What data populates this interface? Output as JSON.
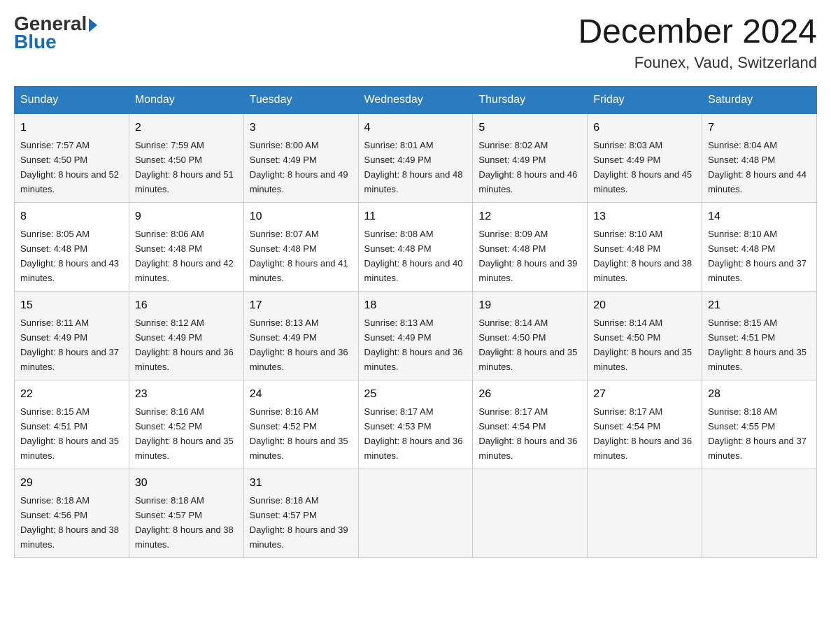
{
  "logo": {
    "general": "General",
    "blue": "Blue"
  },
  "title": "December 2024",
  "location": "Founex, Vaud, Switzerland",
  "days_header": [
    "Sunday",
    "Monday",
    "Tuesday",
    "Wednesday",
    "Thursday",
    "Friday",
    "Saturday"
  ],
  "weeks": [
    [
      {
        "num": "1",
        "sunrise": "7:57 AM",
        "sunset": "4:50 PM",
        "daylight": "8 hours and 52 minutes."
      },
      {
        "num": "2",
        "sunrise": "7:59 AM",
        "sunset": "4:50 PM",
        "daylight": "8 hours and 51 minutes."
      },
      {
        "num": "3",
        "sunrise": "8:00 AM",
        "sunset": "4:49 PM",
        "daylight": "8 hours and 49 minutes."
      },
      {
        "num": "4",
        "sunrise": "8:01 AM",
        "sunset": "4:49 PM",
        "daylight": "8 hours and 48 minutes."
      },
      {
        "num": "5",
        "sunrise": "8:02 AM",
        "sunset": "4:49 PM",
        "daylight": "8 hours and 46 minutes."
      },
      {
        "num": "6",
        "sunrise": "8:03 AM",
        "sunset": "4:49 PM",
        "daylight": "8 hours and 45 minutes."
      },
      {
        "num": "7",
        "sunrise": "8:04 AM",
        "sunset": "4:48 PM",
        "daylight": "8 hours and 44 minutes."
      }
    ],
    [
      {
        "num": "8",
        "sunrise": "8:05 AM",
        "sunset": "4:48 PM",
        "daylight": "8 hours and 43 minutes."
      },
      {
        "num": "9",
        "sunrise": "8:06 AM",
        "sunset": "4:48 PM",
        "daylight": "8 hours and 42 minutes."
      },
      {
        "num": "10",
        "sunrise": "8:07 AM",
        "sunset": "4:48 PM",
        "daylight": "8 hours and 41 minutes."
      },
      {
        "num": "11",
        "sunrise": "8:08 AM",
        "sunset": "4:48 PM",
        "daylight": "8 hours and 40 minutes."
      },
      {
        "num": "12",
        "sunrise": "8:09 AM",
        "sunset": "4:48 PM",
        "daylight": "8 hours and 39 minutes."
      },
      {
        "num": "13",
        "sunrise": "8:10 AM",
        "sunset": "4:48 PM",
        "daylight": "8 hours and 38 minutes."
      },
      {
        "num": "14",
        "sunrise": "8:10 AM",
        "sunset": "4:48 PM",
        "daylight": "8 hours and 37 minutes."
      }
    ],
    [
      {
        "num": "15",
        "sunrise": "8:11 AM",
        "sunset": "4:49 PM",
        "daylight": "8 hours and 37 minutes."
      },
      {
        "num": "16",
        "sunrise": "8:12 AM",
        "sunset": "4:49 PM",
        "daylight": "8 hours and 36 minutes."
      },
      {
        "num": "17",
        "sunrise": "8:13 AM",
        "sunset": "4:49 PM",
        "daylight": "8 hours and 36 minutes."
      },
      {
        "num": "18",
        "sunrise": "8:13 AM",
        "sunset": "4:49 PM",
        "daylight": "8 hours and 36 minutes."
      },
      {
        "num": "19",
        "sunrise": "8:14 AM",
        "sunset": "4:50 PM",
        "daylight": "8 hours and 35 minutes."
      },
      {
        "num": "20",
        "sunrise": "8:14 AM",
        "sunset": "4:50 PM",
        "daylight": "8 hours and 35 minutes."
      },
      {
        "num": "21",
        "sunrise": "8:15 AM",
        "sunset": "4:51 PM",
        "daylight": "8 hours and 35 minutes."
      }
    ],
    [
      {
        "num": "22",
        "sunrise": "8:15 AM",
        "sunset": "4:51 PM",
        "daylight": "8 hours and 35 minutes."
      },
      {
        "num": "23",
        "sunrise": "8:16 AM",
        "sunset": "4:52 PM",
        "daylight": "8 hours and 35 minutes."
      },
      {
        "num": "24",
        "sunrise": "8:16 AM",
        "sunset": "4:52 PM",
        "daylight": "8 hours and 35 minutes."
      },
      {
        "num": "25",
        "sunrise": "8:17 AM",
        "sunset": "4:53 PM",
        "daylight": "8 hours and 36 minutes."
      },
      {
        "num": "26",
        "sunrise": "8:17 AM",
        "sunset": "4:54 PM",
        "daylight": "8 hours and 36 minutes."
      },
      {
        "num": "27",
        "sunrise": "8:17 AM",
        "sunset": "4:54 PM",
        "daylight": "8 hours and 36 minutes."
      },
      {
        "num": "28",
        "sunrise": "8:18 AM",
        "sunset": "4:55 PM",
        "daylight": "8 hours and 37 minutes."
      }
    ],
    [
      {
        "num": "29",
        "sunrise": "8:18 AM",
        "sunset": "4:56 PM",
        "daylight": "8 hours and 38 minutes."
      },
      {
        "num": "30",
        "sunrise": "8:18 AM",
        "sunset": "4:57 PM",
        "daylight": "8 hours and 38 minutes."
      },
      {
        "num": "31",
        "sunrise": "8:18 AM",
        "sunset": "4:57 PM",
        "daylight": "8 hours and 39 minutes."
      },
      null,
      null,
      null,
      null
    ]
  ]
}
